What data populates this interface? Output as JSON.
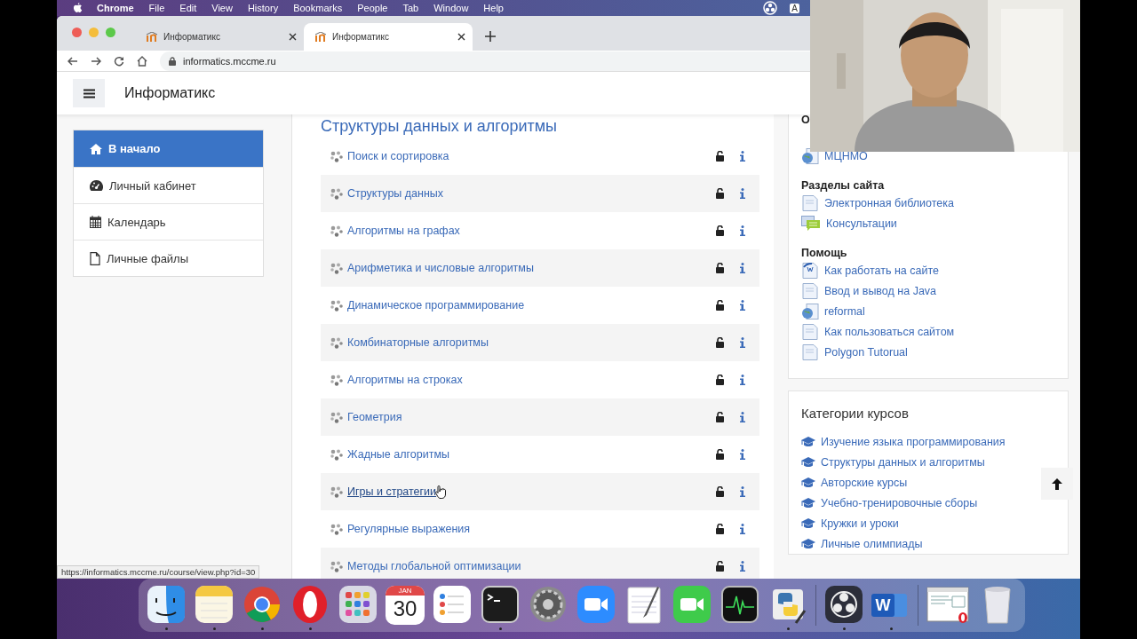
{
  "menu_bar": {
    "app": "Chrome",
    "items": [
      "File",
      "Edit",
      "View",
      "History",
      "Bookmarks",
      "People",
      "Tab",
      "Window",
      "Help"
    ],
    "input_source": "A"
  },
  "tabs": [
    {
      "title": "Информатикс",
      "selected": false
    },
    {
      "title": "Информатикс",
      "selected": true
    }
  ],
  "address_bar": {
    "url": "informatics.mccme.ru"
  },
  "header": {
    "site_title": "Информатикс"
  },
  "nav": [
    {
      "label": "В начало",
      "kind": "home",
      "selected": true
    },
    {
      "label": "Личный кабинет",
      "kind": "dashboard",
      "selected": false
    },
    {
      "label": "Календарь",
      "kind": "calendar",
      "selected": false
    },
    {
      "label": "Личные файлы",
      "kind": "file",
      "selected": false
    }
  ],
  "course": {
    "heading": "Структуры данных и алгоритмы",
    "sections": [
      {
        "title": "Поиск и сортировка",
        "hovered": false
      },
      {
        "title": "Структуры данных",
        "hovered": false
      },
      {
        "title": "Алгоритмы на графах",
        "hovered": false
      },
      {
        "title": "Арифметика и числовые алгоритмы",
        "hovered": false
      },
      {
        "title": "Динамическое программирование",
        "hovered": false
      },
      {
        "title": "Комбинаторные алгоритмы",
        "hovered": false
      },
      {
        "title": "Алгоритмы на строках",
        "hovered": false
      },
      {
        "title": "Геометрия",
        "hovered": false
      },
      {
        "title": "Жадные алгоритмы",
        "hovered": false
      },
      {
        "title": "Игры и стратегии",
        "hovered": true
      },
      {
        "title": "Регулярные выражения",
        "hovered": false
      },
      {
        "title": "Методы глобальной оптимизации",
        "hovered": false
      }
    ]
  },
  "links_block": {
    "groups": [
      {
        "heading": "О",
        "items": [
          {
            "label": "МЦНМО",
            "kind": "globe"
          }
        ]
      },
      {
        "heading": "Разделы сайта",
        "items": [
          {
            "label": "Электронная библиотека",
            "kind": "page"
          },
          {
            "label": "Консультации",
            "kind": "chat"
          }
        ]
      },
      {
        "heading": "Помощь",
        "items": [
          {
            "label": "Как работать на сайте",
            "kind": "word"
          },
          {
            "label": "Ввод и вывод на Java",
            "kind": "page"
          },
          {
            "label": "reformal",
            "kind": "globe"
          },
          {
            "label": "Как пользоваться сайтом",
            "kind": "page"
          },
          {
            "label": "Polygon Tutorual",
            "kind": "page"
          }
        ]
      }
    ]
  },
  "categories": {
    "title": "Категории курсов",
    "items": [
      "Изучение языка программирования",
      "Структуры данных и алгоритмы",
      "Авторские курсы",
      "Учебно-тренировочные сборы",
      "Кружки и уроки",
      "Личные олимпиады"
    ]
  },
  "status_url": "https://informatics.mccme.ru/course/view.php?id=30",
  "dock": [
    {
      "kind": "finder",
      "running": true
    },
    {
      "kind": "notes",
      "running": true
    },
    {
      "kind": "chrome",
      "running": true
    },
    {
      "kind": "opera",
      "running": true
    },
    {
      "kind": "launchpad",
      "running": false
    },
    {
      "kind": "calendar",
      "running": false,
      "month": "JAN",
      "day": "30"
    },
    {
      "kind": "reminders",
      "running": false
    },
    {
      "kind": "terminal",
      "running": true
    },
    {
      "kind": "settings",
      "running": false
    },
    {
      "kind": "zoom",
      "running": false
    },
    {
      "kind": "textedit",
      "running": false
    },
    {
      "kind": "facetime",
      "running": false
    },
    {
      "kind": "activity",
      "running": false
    },
    {
      "kind": "python",
      "running": true
    },
    {
      "kind": "separator"
    },
    {
      "kind": "obs",
      "running": true
    },
    {
      "kind": "word",
      "running": true,
      "letter": "W"
    },
    {
      "kind": "separator"
    },
    {
      "kind": "preview",
      "running": false
    },
    {
      "kind": "trash",
      "running": false
    }
  ]
}
